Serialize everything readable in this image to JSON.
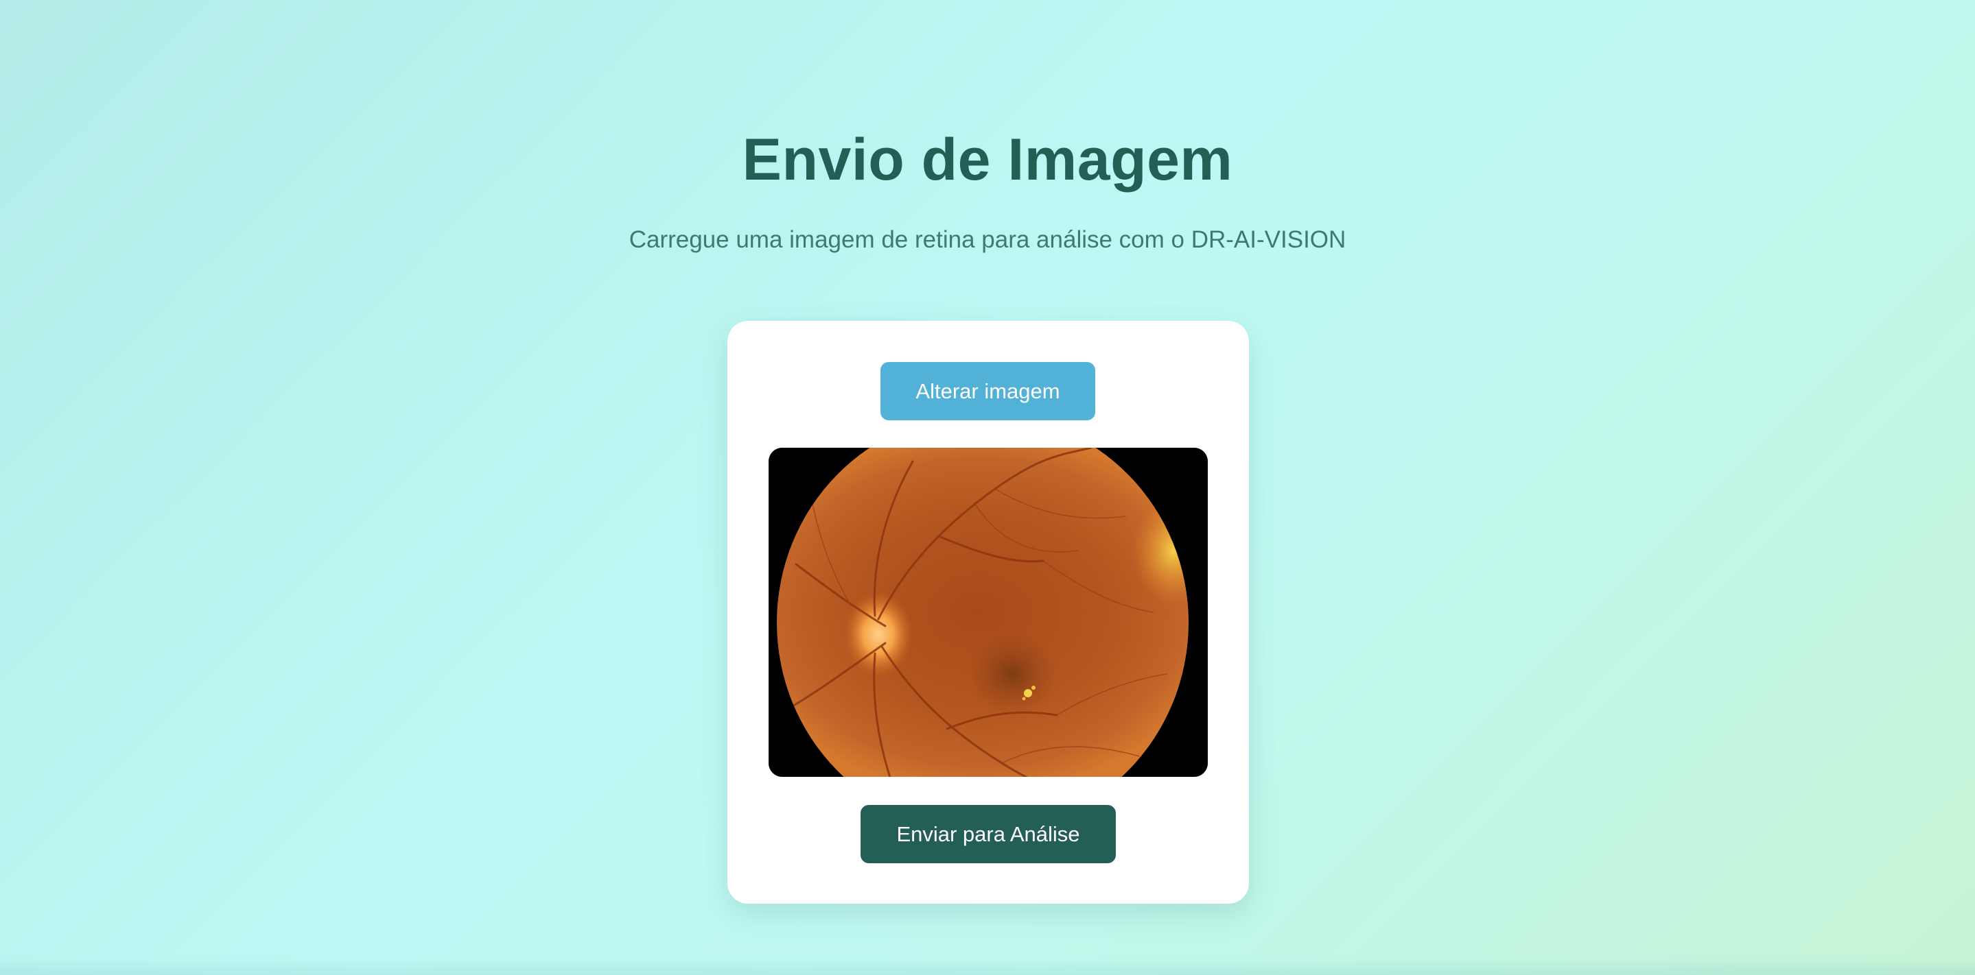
{
  "page": {
    "title": "Envio de Imagem",
    "subtitle": "Carregue uma imagem de retina para análise com o DR-AI-VISION"
  },
  "upload_card": {
    "change_button_label": "Alterar imagem",
    "submit_button_label": "Enviar para Análise",
    "preview_image_alt": "retina-fundus-image"
  },
  "colors": {
    "title": "#235f55",
    "subtitle": "#3d7b72",
    "change_button": "#52b1d6",
    "submit_button": "#235f55",
    "card": "#ffffff"
  }
}
